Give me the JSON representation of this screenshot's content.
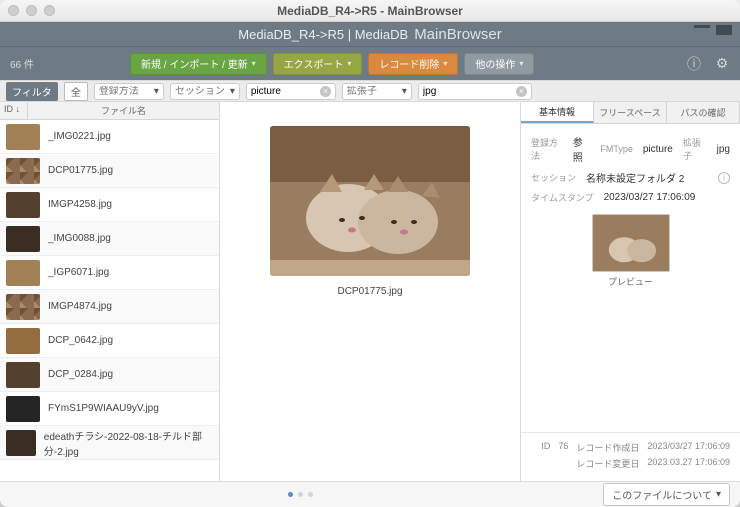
{
  "window": {
    "title": "MediaDB_R4->R5 - MainBrowser"
  },
  "subheader": {
    "prefix": "MediaDB_R4->R5 | MediaDB",
    "appname": "MainBrowser"
  },
  "toolbar": {
    "count_label": "66 件",
    "btn_new": "新規 / インポート / 更新",
    "btn_export": "エクスポート",
    "btn_delete": "レコード削除",
    "btn_other": "他の操作"
  },
  "filter": {
    "label": "フィルタ",
    "all": "全",
    "f1_label": "登録方法",
    "f2_label": "セッション",
    "f3_value": "picture",
    "f4_label": "拡張子",
    "f5_value": "jpg"
  },
  "list": {
    "hdr_id": "ID ↓",
    "hdr_name": "ファイル名",
    "items": [
      {
        "name": "_IMG0221.jpg",
        "tv": "v3"
      },
      {
        "name": "DCP01775.jpg",
        "tv": "",
        "sel": true
      },
      {
        "name": "IMGP4258.jpg",
        "tv": "v4"
      },
      {
        "name": "_IMG0088.jpg",
        "tv": "v2"
      },
      {
        "name": "_IGP6071.jpg",
        "tv": "v3"
      },
      {
        "name": "IMGP4874.jpg",
        "tv": ""
      },
      {
        "name": "DCP_0642.jpg",
        "tv": "v5"
      },
      {
        "name": "DCP_0284.jpg",
        "tv": "v4"
      },
      {
        "name": "FYmS1P9WIAAU9yV.jpg",
        "tv": "v6"
      },
      {
        "name": "edeathチラシ-2022-08-18-チルド部分-2.jpg",
        "tv": "v2"
      }
    ]
  },
  "center": {
    "filename": "DCP01775.jpg"
  },
  "right": {
    "tabs": {
      "t1": "基本情報",
      "t2": "フリースペース",
      "t3": "パスの確認"
    },
    "labels": {
      "reg_method": "登録方法",
      "ref": "参照",
      "fmtype": "FMType",
      "fmtype_v": "picture",
      "ext": "拡張子",
      "ext_v": "jpg",
      "session": "セッション",
      "session_v": "名称未設定フォルダ 2",
      "timestamp": "タイムスタンプ",
      "timestamp_v": "2023/03/27 17:06:09",
      "preview": "プレビュー",
      "id_k": "ID",
      "id_v": "76",
      "created_k": "レコード作成日",
      "created_v": "2023/03/27 17:06:09",
      "modified_k": "レコード変更日",
      "modified_v": "2023.03.27 17:06:09"
    }
  },
  "footer": {
    "about_btn": "このファイルについて"
  }
}
